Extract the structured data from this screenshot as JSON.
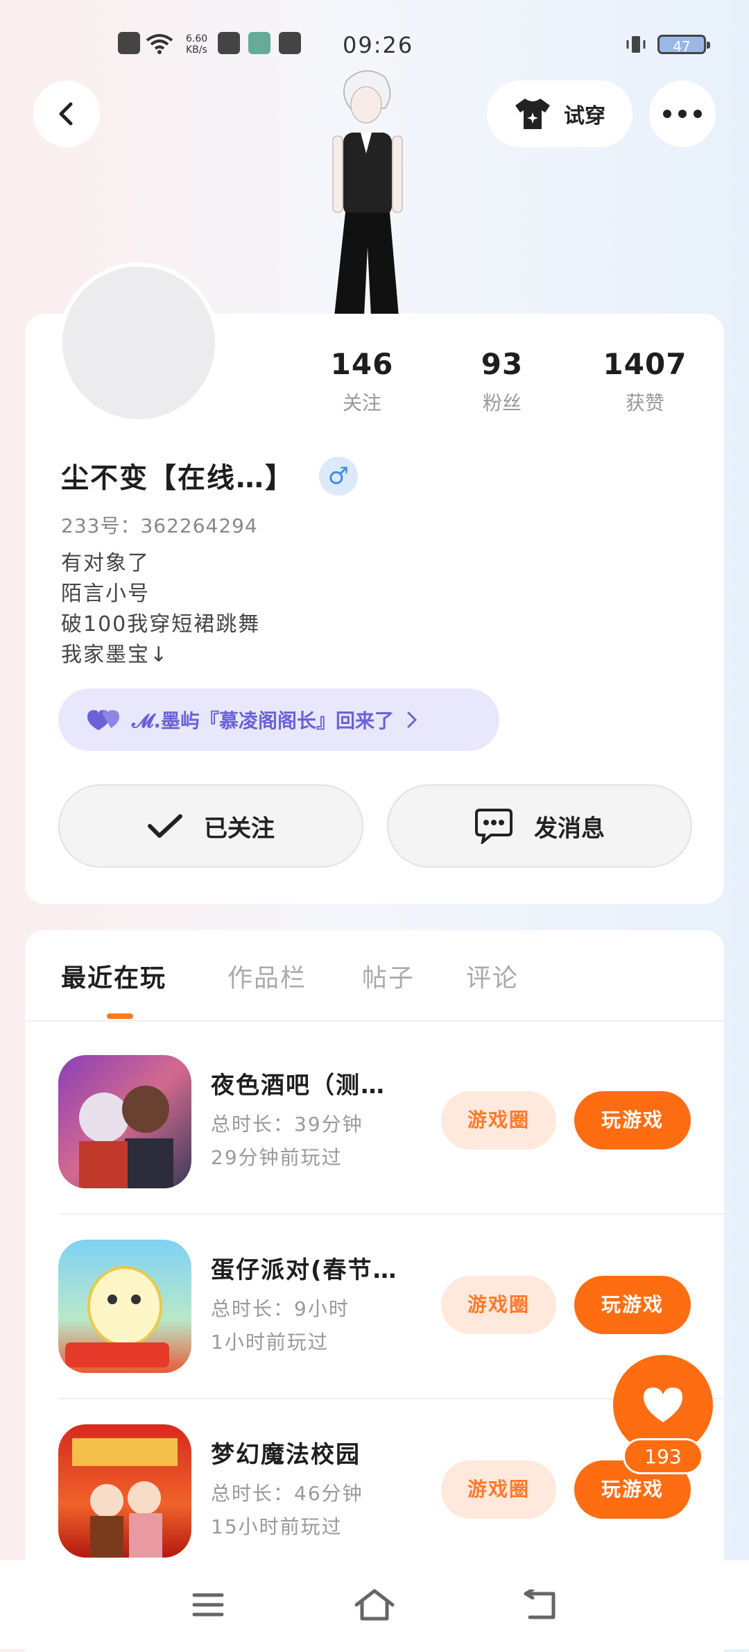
{
  "status_bar": {
    "time": "09:26",
    "network_speed": "6.60 KB/s",
    "battery": "47"
  },
  "header": {
    "back_icon": "chevron-left-icon",
    "try_on_label": "试穿",
    "more_icon": "more-dots-icon"
  },
  "profile": {
    "stats": [
      {
        "value": "146",
        "label": "关注"
      },
      {
        "value": "93",
        "label": "粉丝"
      },
      {
        "value": "1407",
        "label": "获赞"
      }
    ],
    "name": "尘不变【在线…】",
    "gender_symbol": "♂",
    "uid": "233号：362264294",
    "bio": [
      "有对象了",
      "陌言小号",
      "破100我穿短裙跳舞",
      "我家墨宝↓"
    ],
    "relation_pill": "𝓜.墨屿『慕凌阁阁长』回来了",
    "follow_label": "已关注",
    "message_label": "发消息"
  },
  "tabs": [
    "最近在玩",
    "作品栏",
    "帖子",
    "评论"
  ],
  "games": [
    {
      "title": "夜色酒吧（测…",
      "duration": "总时长：39分钟",
      "last_played": "29分钟前玩过",
      "circle_label": "游戏圈",
      "play_label": "玩游戏"
    },
    {
      "title": "蛋仔派对(春节…",
      "duration": "总时长：9小时",
      "last_played": "1小时前玩过",
      "circle_label": "游戏圈",
      "play_label": "玩游戏"
    },
    {
      "title": "梦幻魔法校园",
      "duration": "总时长：46分钟",
      "last_played": "15小时前玩过",
      "circle_label": "游戏圈",
      "play_label": "玩游戏"
    }
  ],
  "like_fab": {
    "count": "193"
  },
  "colors": {
    "accent": "#ff6d12",
    "pill_bg": "#e8e7fb",
    "pill_text": "#6a62d6"
  }
}
